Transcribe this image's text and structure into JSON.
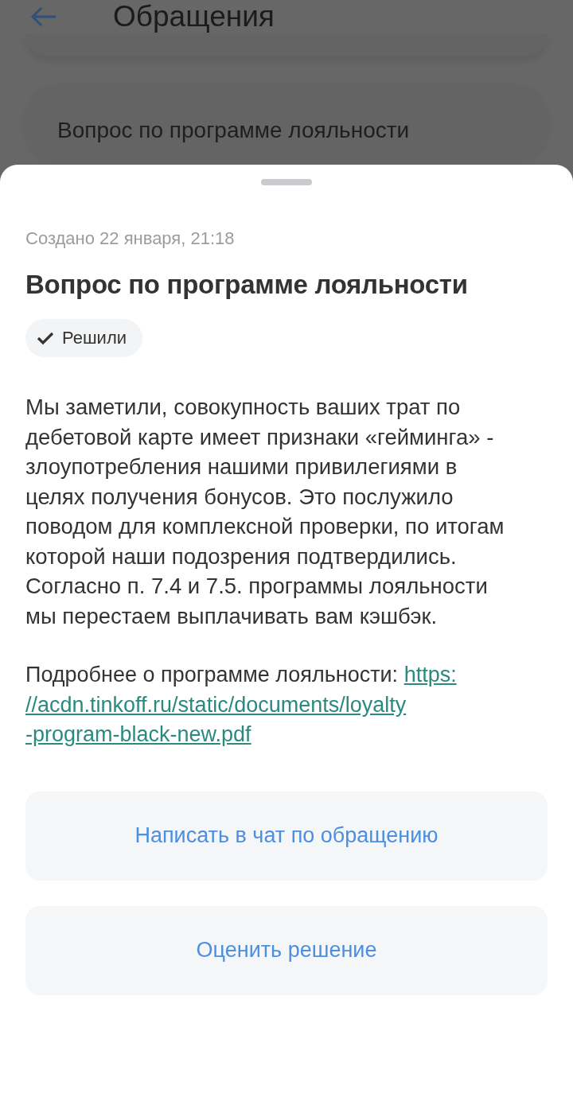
{
  "header": {
    "title": "Обращения"
  },
  "background_cards": [
    {
      "title": "Вопрос по программе лояльности"
    }
  ],
  "sheet": {
    "created": "Создано 22 января, 21:18",
    "title": "Вопрос по программе лояльности",
    "status": {
      "label": "Решили",
      "resolved": true
    },
    "paragraphs": [
      "Мы заметили, совокупность ваших трат по дебетовой карте имеет признаки «гейминга» - злоупотребления нашими привилегиями в целях получения бонусов. Это послужило поводом для комплексной проверки, по итогам которой наши подозрения подтвердились.",
      "Согласно п. 7.4 и 7.5. программы лояльности мы перестаем выплачивать вам кэшбэк."
    ],
    "more": {
      "text": "Подробнее о программе лояльности:",
      "link_lines": [
        "https:",
        "//acdn.tinkoff.ru/static/documents/loyalty",
        "-program-black-new.pdf"
      ]
    },
    "buttons": [
      "Написать в чат по обращению",
      "Оценить решение"
    ]
  }
}
